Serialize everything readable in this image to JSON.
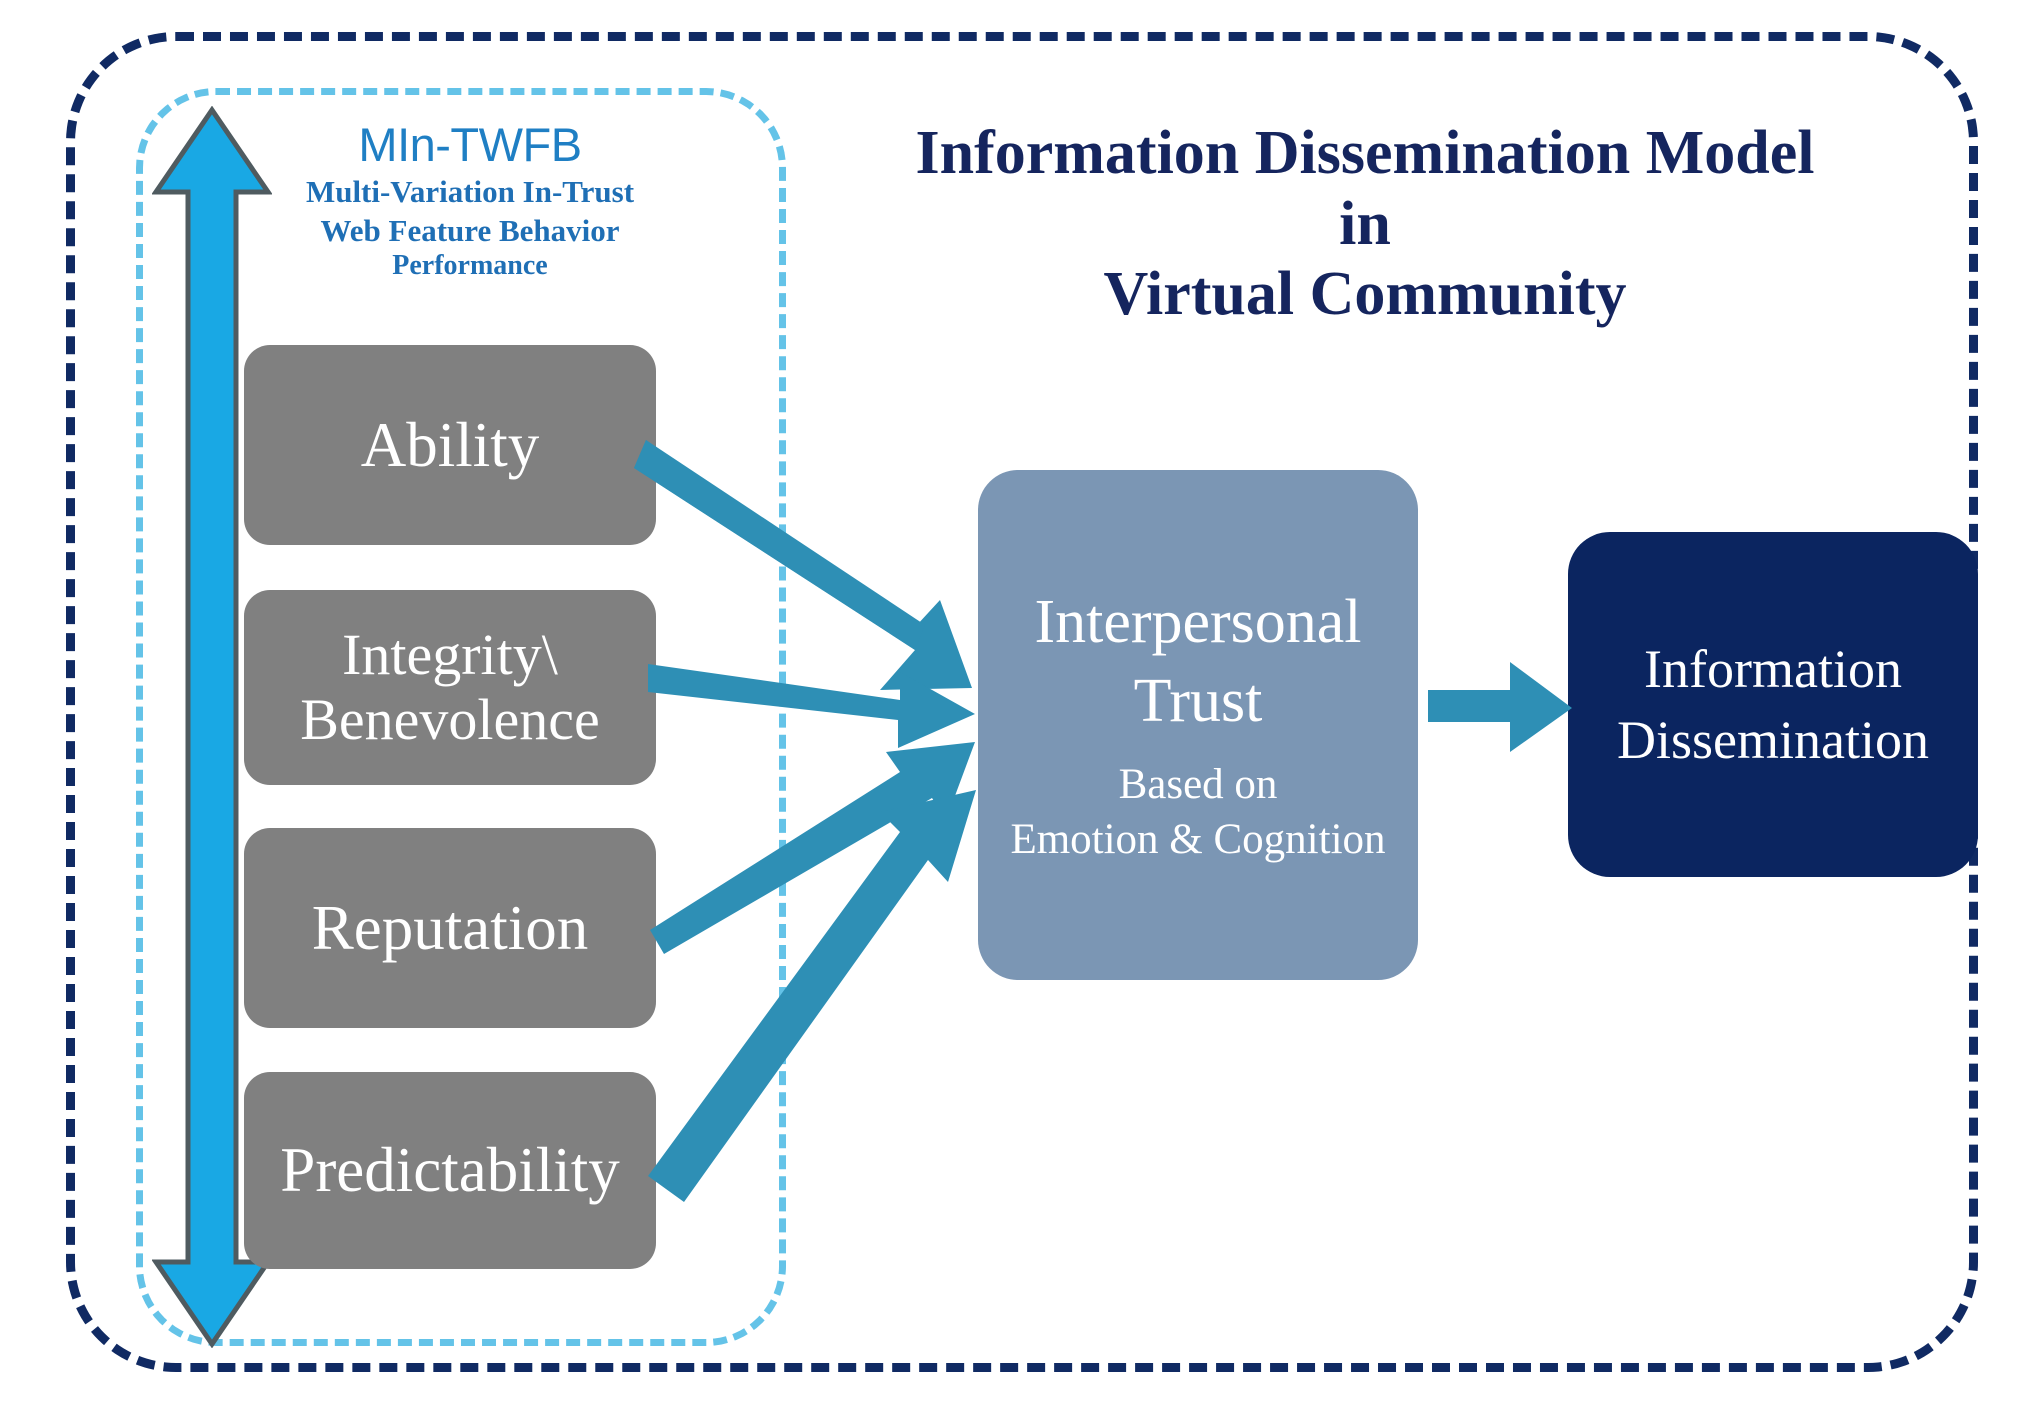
{
  "heading": {
    "line1": "Information Dissemination Model",
    "line2": "in",
    "line3": "Virtual Community"
  },
  "framework_caption": {
    "acronym": "MIn-TWFB",
    "expansion_line1": "Multi-Variation In-Trust",
    "expansion_line2": "Web Feature Behavior",
    "expansion_line3": "Performance"
  },
  "factors": [
    {
      "id": "ability",
      "label": "Ability"
    },
    {
      "id": "integrity",
      "label": "Integrity\\",
      "label2": "Benevolence"
    },
    {
      "id": "reputation",
      "label": "Reputation"
    },
    {
      "id": "predictability",
      "label": "Predictability"
    }
  ],
  "trust_node": {
    "title_line1": "Interpersonal",
    "title_line2": "Trust",
    "subtitle_line1": "Based on",
    "subtitle_line2": "Emotion & Cognition"
  },
  "outcome_node": {
    "line1": "Information",
    "line2": "Dissemination"
  },
  "icons": {
    "vertical_double_arrow": "double-headed-up-down-arrow",
    "factor_to_trust_arrow": "arrow-right",
    "trust_to_outcome_arrow": "arrow-right"
  },
  "colors": {
    "outer_frame": "#102A63",
    "inner_frame": "#64C3E8",
    "vertical_arrow_fill": "#19A8E4",
    "vertical_arrow_stroke": "#4F5B60",
    "factor_box": "#808080",
    "trust_box": "#7B96B4",
    "outcome_box": "#0B2560",
    "connector_arrow": "#2E8FB5",
    "heading_text": "#15255E",
    "caption_text": "#1F7FC4",
    "box_text": "#FFFFFF"
  },
  "chart_data": {
    "type": "diagram",
    "title": "Information Dissemination Model in Virtual Community",
    "nodes": [
      {
        "id": "ability",
        "label": "Ability",
        "group": "MIn-TWFB"
      },
      {
        "id": "integrity",
        "label": "Integrity\\Benevolence",
        "group": "MIn-TWFB"
      },
      {
        "id": "reputation",
        "label": "Reputation",
        "group": "MIn-TWFB"
      },
      {
        "id": "predictability",
        "label": "Predictability",
        "group": "MIn-TWFB"
      },
      {
        "id": "trust",
        "label": "Interpersonal Trust (Based on Emotion & Cognition)",
        "group": "core"
      },
      {
        "id": "dissemination",
        "label": "Information Dissemination",
        "group": "outcome"
      }
    ],
    "edges": [
      {
        "from": "ability",
        "to": "trust"
      },
      {
        "from": "integrity",
        "to": "trust"
      },
      {
        "from": "reputation",
        "to": "trust"
      },
      {
        "from": "predictability",
        "to": "trust"
      },
      {
        "from": "trust",
        "to": "dissemination"
      }
    ]
  }
}
